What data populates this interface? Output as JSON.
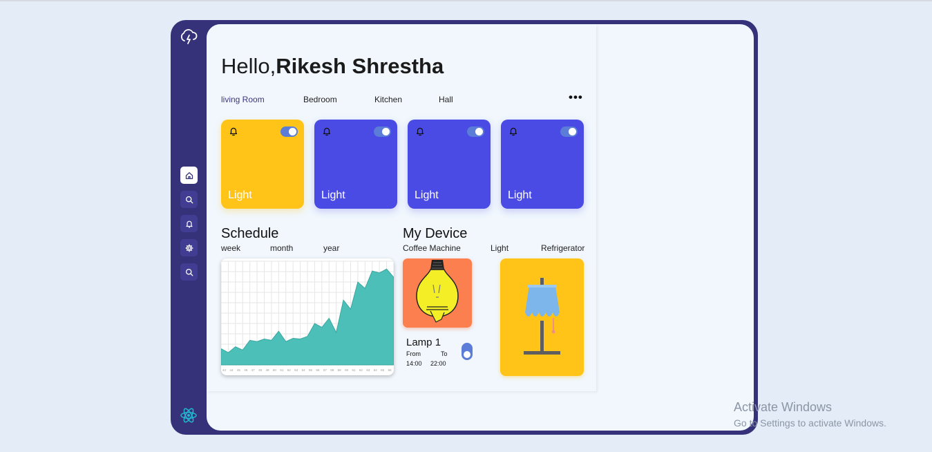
{
  "greeting": {
    "hello": "Hello,",
    "name": "Rikesh Shrestha"
  },
  "rooms": [
    "living Room",
    "Bedroom",
    "Kitchen",
    "Hall"
  ],
  "more_icon": "more-dots-icon",
  "cards": [
    {
      "label": "Light",
      "color": "#ffc417",
      "on": true
    },
    {
      "label": "Light",
      "color": "#4a4ae4",
      "on": true
    },
    {
      "label": "Light",
      "color": "#4a4ae4",
      "on": true
    },
    {
      "label": "Light",
      "color": "#4a4ae4",
      "on": true
    }
  ],
  "schedule": {
    "title": "Schedule",
    "tabs": [
      "week",
      "month",
      "year"
    ]
  },
  "device": {
    "title": "My Device",
    "tabs": [
      "Coffee Machine",
      "Light",
      "Refrigerator"
    ],
    "lamp": {
      "name": "Lamp 1",
      "from_label": "From",
      "to_label": "To",
      "from_time": "14:00",
      "to_time": "22:00"
    }
  },
  "sidebar": {
    "logo_icon": "cloud-lightning-icon",
    "nav": [
      "home-icon",
      "search-icon",
      "bell-icon",
      "gear-icon",
      "search-icon"
    ],
    "footer_icon": "react-icon"
  },
  "watermark": {
    "title": "Activate Windows",
    "subtitle": "Go to Settings to activate Windows."
  },
  "chart_data": {
    "type": "area",
    "x": [
      "43",
      "44",
      "45",
      "46",
      "47",
      "48",
      "49",
      "50",
      "51",
      "52",
      "53",
      "54",
      "55",
      "56",
      "57",
      "58",
      "59",
      "60",
      "61",
      "62",
      "63",
      "64",
      "65",
      "66",
      "67"
    ],
    "values": [
      25,
      19,
      28,
      23,
      38,
      36,
      40,
      38,
      52,
      36,
      41,
      40,
      44,
      64,
      58,
      72,
      50,
      100,
      86,
      128,
      118,
      145,
      142,
      148,
      135
    ],
    "ylim": [
      0,
      160
    ],
    "grid": true,
    "color": "#4bbfb8"
  }
}
